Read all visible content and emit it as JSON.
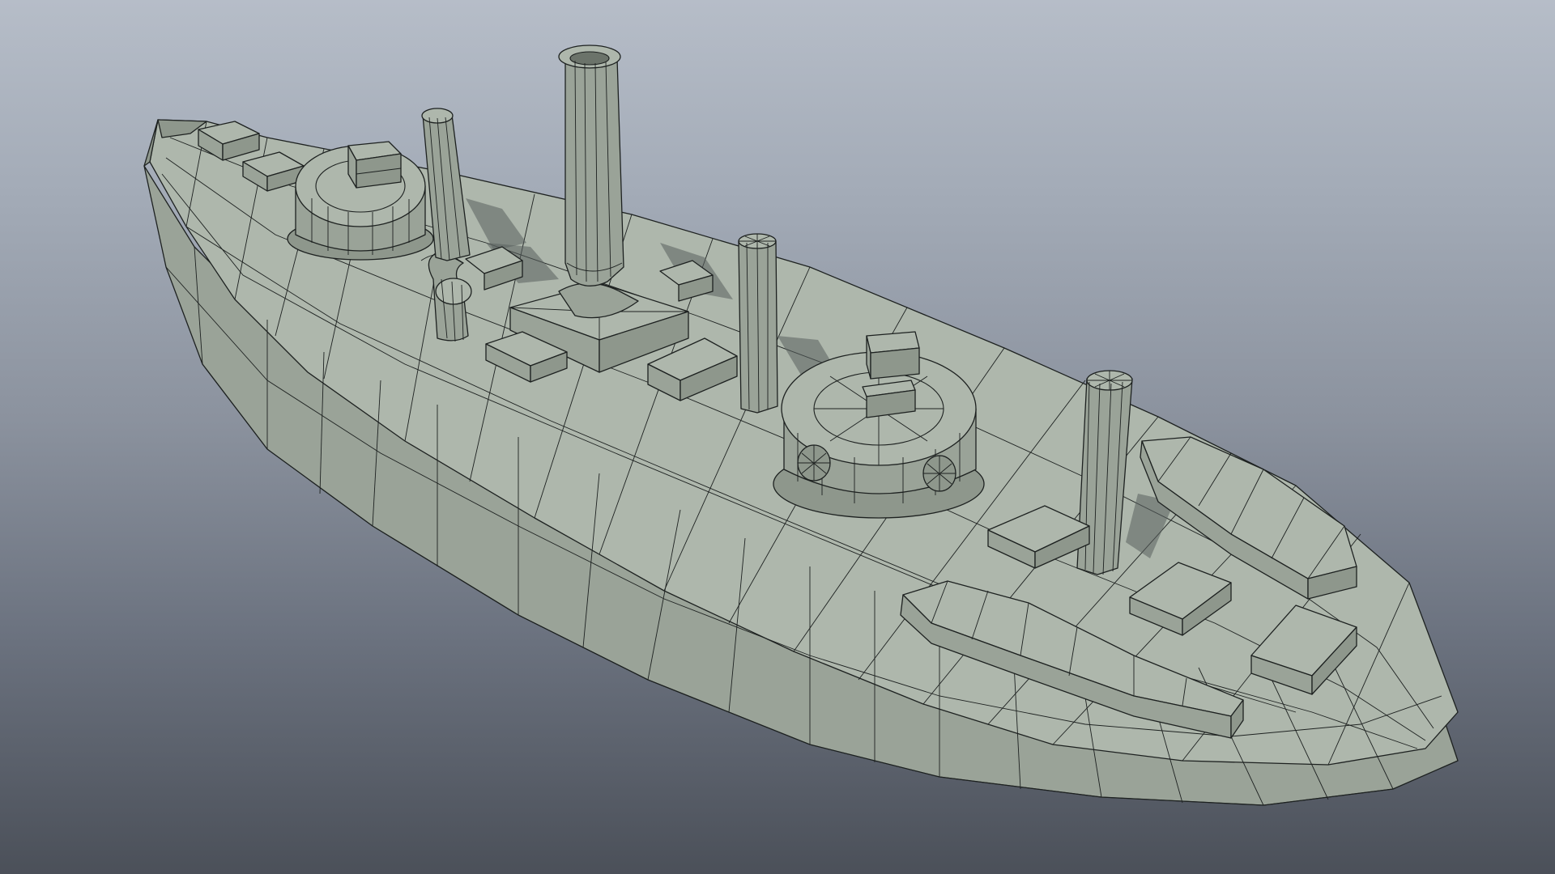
{
  "viewport": {
    "background_top": "#b6bdc8",
    "background_bottom": "#4b5059",
    "mesh_color": "#a9b2a7",
    "wire_color": "#1d2120"
  },
  "model": {
    "display_mode": "wireframe-on-shaded"
  }
}
